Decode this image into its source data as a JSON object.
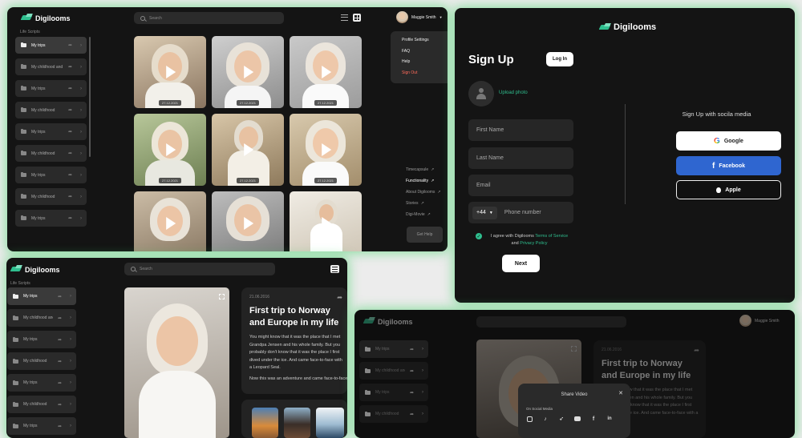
{
  "brand": {
    "name": "Digilooms",
    "accent": "#2fbf8f"
  },
  "search": {
    "placeholder": "Search"
  },
  "user": {
    "name": "Maggie Smith"
  },
  "sidebar": {
    "title": "Life Scripts",
    "items": [
      {
        "label": "My trips"
      },
      {
        "label": "My childhood and all..."
      },
      {
        "label": "My trips"
      },
      {
        "label": "My childhood"
      },
      {
        "label": "My trips"
      },
      {
        "label": "My childhood"
      },
      {
        "label": "My trips"
      },
      {
        "label": "My childhood"
      },
      {
        "label": "My trips"
      }
    ]
  },
  "gallery": {
    "dates": [
      "27.12.2021",
      "27.12.2021",
      "27.12.2021",
      "27.12.2021",
      "27.12.2021",
      "27.12.2021"
    ]
  },
  "profile_menu": {
    "items": [
      "Profile Settings",
      "FAQ",
      "Help"
    ],
    "signout": "Sign Out"
  },
  "footer_nav": {
    "items": [
      "Timecapsule",
      "Functionality",
      "About Digilooms",
      "Stories",
      "Digi-Movie"
    ],
    "help_button": "Get Help"
  },
  "signup": {
    "title": "Sign Up",
    "login_button": "Log In",
    "upload_photo": "Upload photo",
    "first_name": "First Name",
    "last_name": "Last Name",
    "email": "Email",
    "country_code": "+44",
    "phone": "Phone number",
    "agree_prefix": "I agree with Digilooms",
    "terms": "Terms of Service",
    "and": "and",
    "privacy": "Privacy Policy",
    "next_button": "Next",
    "social_title": "Sign Up with socila media",
    "google": "Google",
    "facebook": "Facebook",
    "apple": "Apple",
    "facebook_color": "#2f66d0"
  },
  "story": {
    "date": "21.06.2016",
    "title": "First trip to Norway and Europe in my life",
    "body": "You might know that it was the place that I met Grandpa Jensen and his whole family.  But you probably don't know that it was the place I first dived under the ice. And came face-to-face with a Leopard Seal.",
    "body2": "Now this was an adventure and came face-to-face"
  },
  "share": {
    "title": "Share Video",
    "subtitle": "On Social Media",
    "icons": [
      "instagram-icon",
      "tiktok-icon",
      "twitter-icon",
      "youtube-icon",
      "facebook-icon",
      "linkedin-icon"
    ]
  }
}
